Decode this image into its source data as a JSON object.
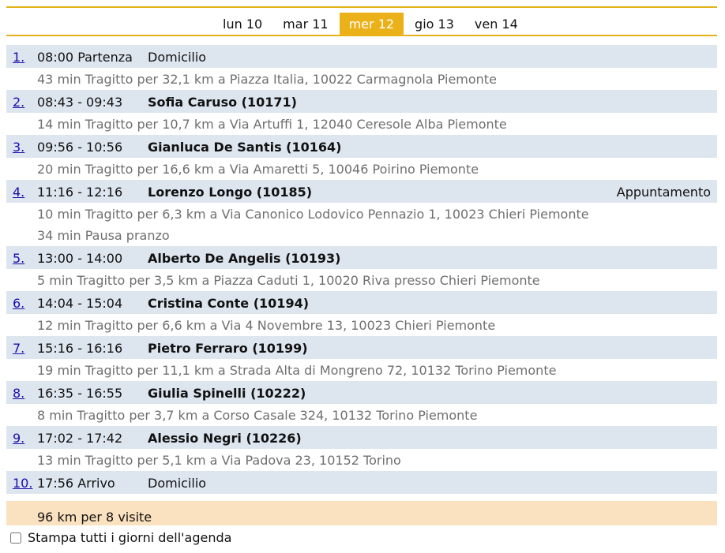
{
  "days": [
    "lun 10",
    "mar 11",
    "mer 12",
    "gio 13",
    "ven 14"
  ],
  "active_day": "mer 12",
  "stops": [
    {
      "num": "1.",
      "time": "08:00 Partenza",
      "name": "Domicilio",
      "bold": false,
      "tag": "",
      "notes": [
        "43 min Tragitto per 32,1 km a Piazza Italia, 10022 Carmagnola Piemonte"
      ]
    },
    {
      "num": "2.",
      "time": "08:43 - 09:43",
      "name": "Sofia Caruso (10171)",
      "bold": true,
      "tag": "",
      "notes": [
        "14 min Tragitto per 10,7 km a Via Artuffi 1, 12040 Ceresole Alba Piemonte"
      ]
    },
    {
      "num": "3.",
      "time": "09:56 - 10:56",
      "name": "Gianluca De Santis (10164)",
      "bold": true,
      "tag": "",
      "notes": [
        "20 min Tragitto per 16,6 km a Via Amaretti 5, 10046 Poirino Piemonte"
      ]
    },
    {
      "num": "4.",
      "time": "11:16 - 12:16",
      "name": "Lorenzo Longo (10185)",
      "bold": true,
      "tag": "Appuntamento",
      "notes": [
        "10 min Tragitto per 6,3 km a Via Canonico Lodovico Pennazio 1, 10023 Chieri Piemonte",
        "34 min Pausa pranzo"
      ]
    },
    {
      "num": "5.",
      "time": "13:00 - 14:00",
      "name": "Alberto De Angelis (10193)",
      "bold": true,
      "tag": "",
      "notes": [
        "5 min Tragitto per 3,5 km a Piazza Caduti 1, 10020 Riva presso Chieri Piemonte"
      ]
    },
    {
      "num": "6.",
      "time": "14:04 - 15:04",
      "name": "Cristina Conte (10194)",
      "bold": true,
      "tag": "",
      "notes": [
        "12 min Tragitto per 6,6 km a Via 4 Novembre 13, 10023 Chieri Piemonte"
      ]
    },
    {
      "num": "7.",
      "time": "15:16 - 16:16",
      "name": "Pietro Ferraro (10199)",
      "bold": true,
      "tag": "",
      "notes": [
        "19 min Tragitto per 11,1 km a Strada Alta di Mongreno 72, 10132 Torino Piemonte"
      ]
    },
    {
      "num": "8.",
      "time": "16:35 - 16:55",
      "name": "Giulia Spinelli (10222)",
      "bold": true,
      "tag": "",
      "notes": [
        "8 min Tragitto per 3,7 km a Corso Casale 324, 10132 Torino Piemonte"
      ]
    },
    {
      "num": "9.",
      "time": "17:02 - 17:42",
      "name": "Alessio Negri (10226)",
      "bold": true,
      "tag": "",
      "notes": [
        "13 min Tragitto per 5,1 km a Via Padova 23, 10152 Torino"
      ]
    },
    {
      "num": "10.",
      "time": "17:56  Arrivo",
      "name": "Domicilio",
      "bold": false,
      "tag": "",
      "notes": []
    }
  ],
  "summary": "96 km per 8 visite",
  "print_all_label": "Stampa tutti i giorni dell'agenda"
}
